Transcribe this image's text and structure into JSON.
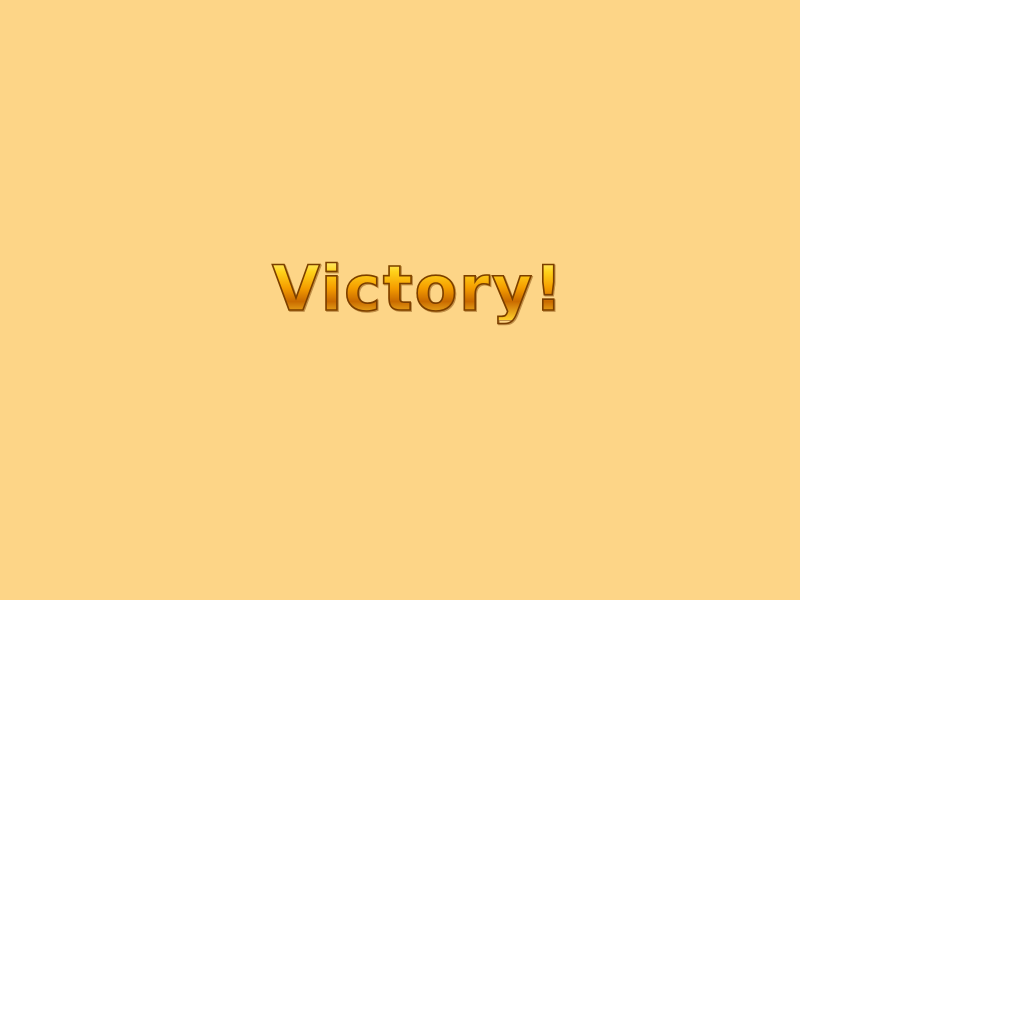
{
  "game": {
    "status_message": "Victory!"
  },
  "colors": {
    "stage_background": "#fdd587",
    "text_gold_light": "#ffd21a",
    "text_gold_dark": "#c96a00",
    "text_outline": "#7a3e00"
  }
}
